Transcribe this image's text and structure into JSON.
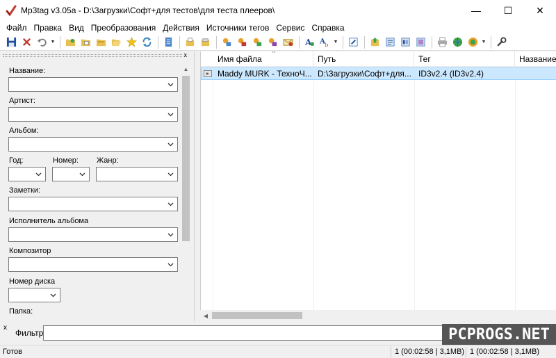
{
  "window": {
    "title": "Mp3tag v3.05a  -  D:\\Загрузки\\Софт+для тестов\\для теста плееров\\",
    "minimize": "—",
    "maximize": "☐",
    "close": "✕"
  },
  "menu": [
    "Файл",
    "Правка",
    "Вид",
    "Преобразования",
    "Действия",
    "Источники тегов",
    "Сервис",
    "Справка"
  ],
  "tag_panel": {
    "close": "x",
    "fields": {
      "title": "Название:",
      "artist": "Артист:",
      "album": "Альбом:",
      "year": "Год:",
      "track": "Номер:",
      "genre": "Жанр:",
      "comment": "Заметки:",
      "album_artist": "Исполнитель альбома",
      "composer": "Композитор",
      "disc_number": "Номер диска",
      "folder": "Папка:"
    }
  },
  "file_list": {
    "columns": [
      "Имя файла",
      "Путь",
      "Тег",
      "Название"
    ],
    "rows": [
      {
        "filename": "Maddy MURK - ТехноЧ...",
        "path": "D:\\Загрузки\\Софт+для...",
        "tag": "ID3v2.4 (ID3v2.4)",
        "title": ""
      }
    ]
  },
  "filter": {
    "close": "x",
    "label": "Фильтр",
    "value": ""
  },
  "watermark": "PCPROGS.NET",
  "status": {
    "left": "Готов",
    "selected": "1 (00:02:58 | 3,1MB)",
    "total": "1 (00:02:58 | 3,1MB)"
  },
  "colors": {
    "selection": "#cce8ff",
    "selection_border": "#99d1ff",
    "watermark_bg": "#555555"
  }
}
